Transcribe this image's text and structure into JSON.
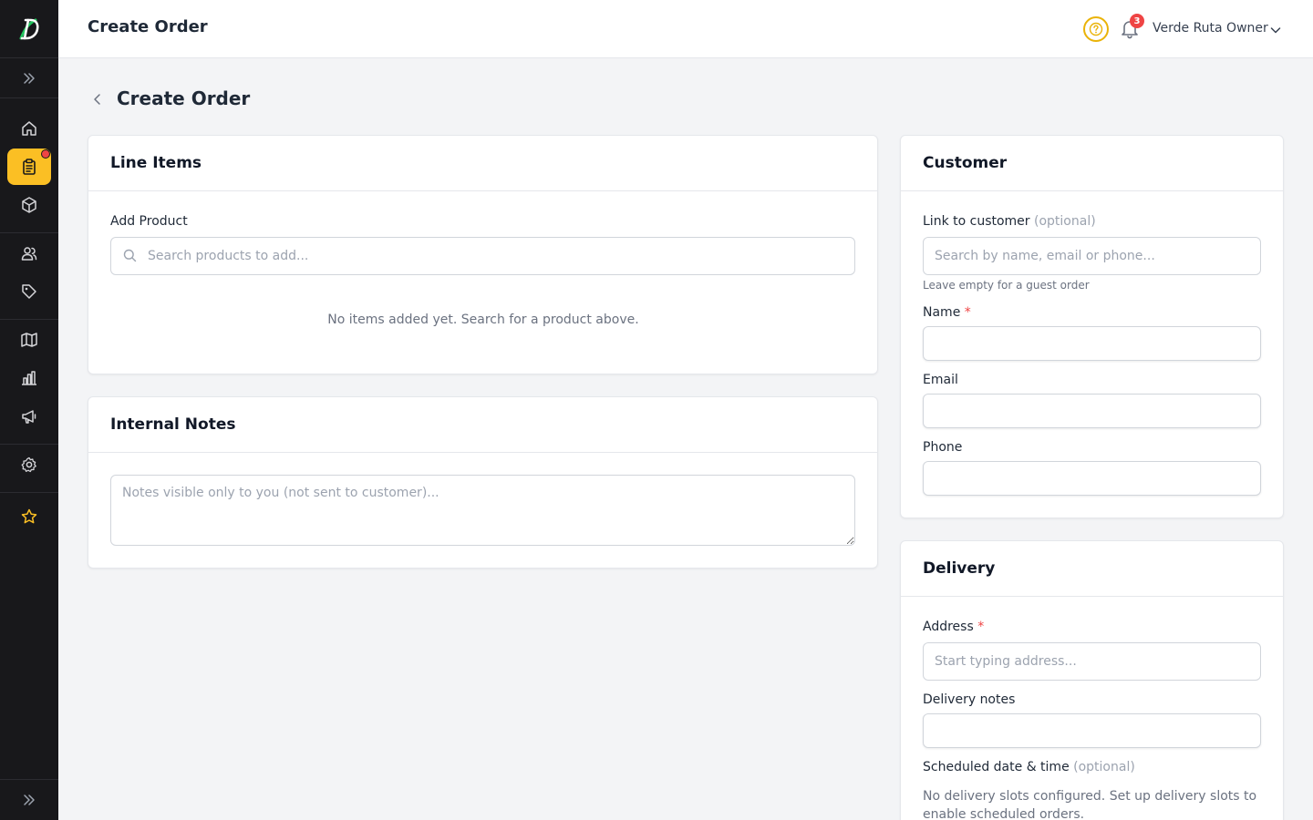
{
  "header": {
    "title": "Create Order",
    "notification_count": "3",
    "user_name": "Verde Ruta Owner"
  },
  "page": {
    "title": "Create Order"
  },
  "sidebar": {
    "items": [
      {
        "name": "home-icon"
      },
      {
        "name": "orders-icon",
        "active": true
      },
      {
        "name": "box-icon"
      },
      {
        "name": "users-icon"
      },
      {
        "name": "tag-icon"
      },
      {
        "name": "map-icon"
      },
      {
        "name": "chart-icon"
      },
      {
        "name": "megaphone-icon"
      },
      {
        "name": "gear-icon"
      },
      {
        "name": "star-icon"
      }
    ]
  },
  "line_items": {
    "title": "Line Items",
    "add_product_label": "Add Product",
    "search_placeholder": "Search products to add...",
    "empty_message": "No items added yet. Search for a product above."
  },
  "notes": {
    "title": "Internal Notes",
    "placeholder": "Notes visible only to you (not sent to customer)..."
  },
  "customer": {
    "title": "Customer",
    "link_label": "Link to customer",
    "link_optional": "(optional)",
    "search_placeholder": "Search by name, email or phone...",
    "hint": "Leave empty for a guest order",
    "name_label": "Name",
    "required_mark": "*",
    "email_label": "Email",
    "phone_label": "Phone"
  },
  "delivery": {
    "title": "Delivery",
    "address_label": "Address",
    "required_mark": "*",
    "address_placeholder": "Start typing address...",
    "notes_label": "Delivery notes",
    "schedule_label": "Scheduled date & time",
    "schedule_optional": "(optional)",
    "no_slots_message": "No delivery slots configured. Set up delivery slots to enable scheduled orders."
  },
  "colors": {
    "accent": "#fbbf24",
    "sidebar_bg": "#18181b",
    "danger": "#ef4444"
  }
}
